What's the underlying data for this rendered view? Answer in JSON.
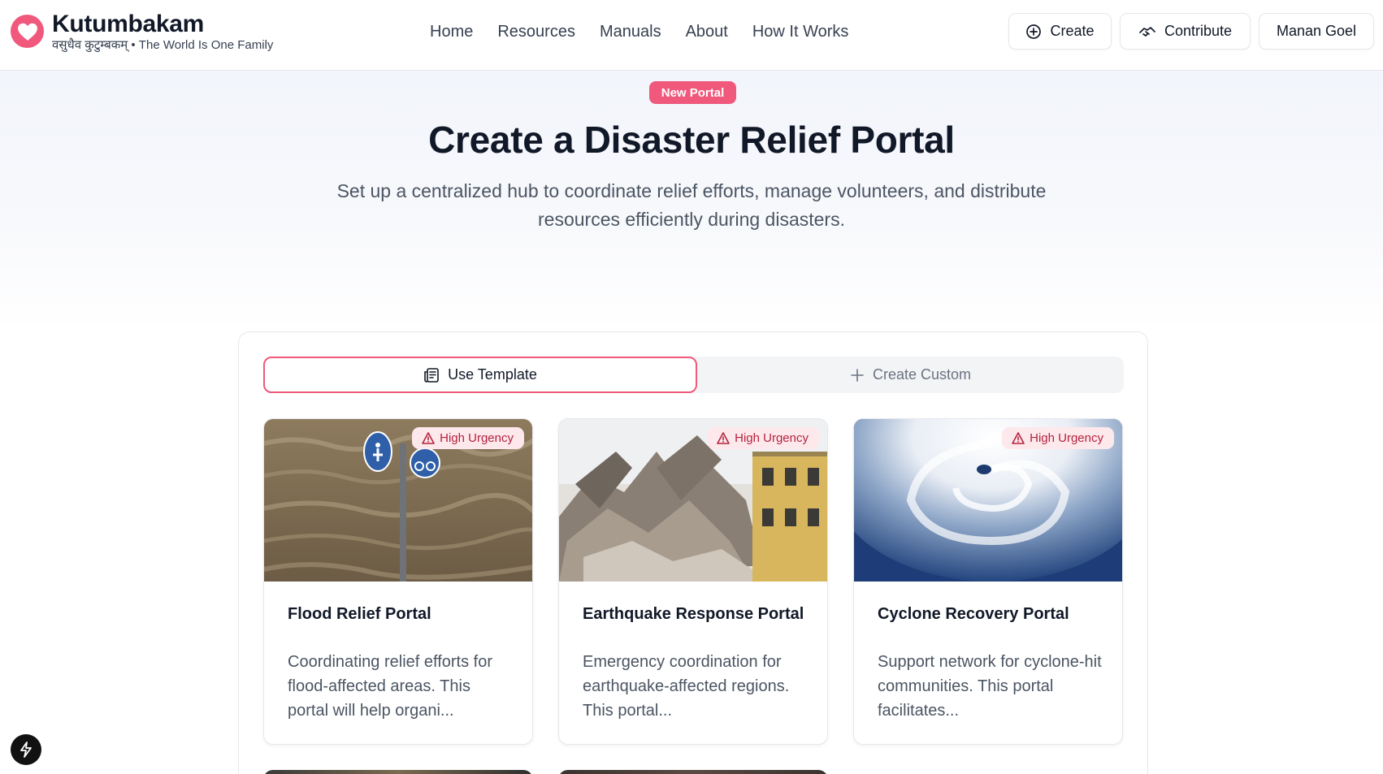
{
  "brand": {
    "name": "Kutumbakam",
    "tagline": "वसुधैव कुटुम्बकम् • The World Is One Family",
    "accent_color": "#f0587c"
  },
  "nav": {
    "items": [
      {
        "label": "Home"
      },
      {
        "label": "Resources"
      },
      {
        "label": "Manuals"
      },
      {
        "label": "About"
      },
      {
        "label": "How It Works"
      }
    ]
  },
  "header_actions": {
    "create_label": "Create",
    "create_icon": "plus-circle-icon",
    "contribute_label": "Contribute",
    "contribute_icon": "handshake-icon",
    "user_label": "Manan Goel"
  },
  "hero": {
    "badge": "New Portal",
    "title": "Create a Disaster Relief Portal",
    "subtitle": "Set up a centralized hub to coordinate relief efforts, manage volunteers, and distribute resources efficiently during disasters."
  },
  "tabs": {
    "template_label": "Use Template",
    "template_icon": "newspaper-icon",
    "custom_label": "Create Custom",
    "custom_icon": "plus-icon",
    "active": "Use Template"
  },
  "templates": [
    {
      "title": "Flood Relief Portal",
      "description": "Coordinating relief efforts for flood-affected areas. This portal will help organi...",
      "urgency": "High Urgency",
      "image": "flooded-street-signs"
    },
    {
      "title": "Earthquake Response Portal",
      "description": "Emergency coordination for earthquake-affected regions. This portal...",
      "urgency": "High Urgency",
      "image": "collapsed-building-rubble"
    },
    {
      "title": "Cyclone Recovery Portal",
      "description": "Support network for cyclone-hit communities. This portal facilitates...",
      "urgency": "High Urgency",
      "image": "cyclone-satellite-view"
    }
  ],
  "floating": {
    "icon": "lightning-bolt-icon"
  }
}
